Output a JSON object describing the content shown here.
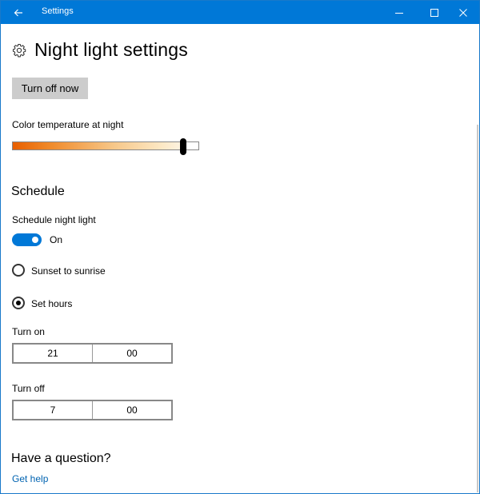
{
  "titlebar": {
    "title": "Settings",
    "icons": {
      "back": "back-arrow-icon",
      "minimize": "minimize-icon",
      "maximize": "maximize-icon",
      "close": "close-icon"
    }
  },
  "page": {
    "title": "Night light settings",
    "title_icon": "gear-icon"
  },
  "turn_off_button": {
    "label": "Turn off now"
  },
  "color_temperature": {
    "label": "Color temperature at night",
    "value_fraction": 0.92
  },
  "schedule": {
    "heading": "Schedule",
    "toggle_label": "Schedule night light",
    "toggle_state": "On",
    "options": [
      {
        "label": "Sunset to sunrise",
        "selected": false
      },
      {
        "label": "Set hours",
        "selected": true
      }
    ],
    "turn_on": {
      "label": "Turn on",
      "hour": "21",
      "minute": "00"
    },
    "turn_off": {
      "label": "Turn off",
      "hour": "7",
      "minute": "00"
    }
  },
  "help": {
    "heading": "Have a question?",
    "link": "Get help"
  },
  "colors": {
    "accent": "#0078d7",
    "link": "#0063b1",
    "button_bg": "#cccccc"
  }
}
